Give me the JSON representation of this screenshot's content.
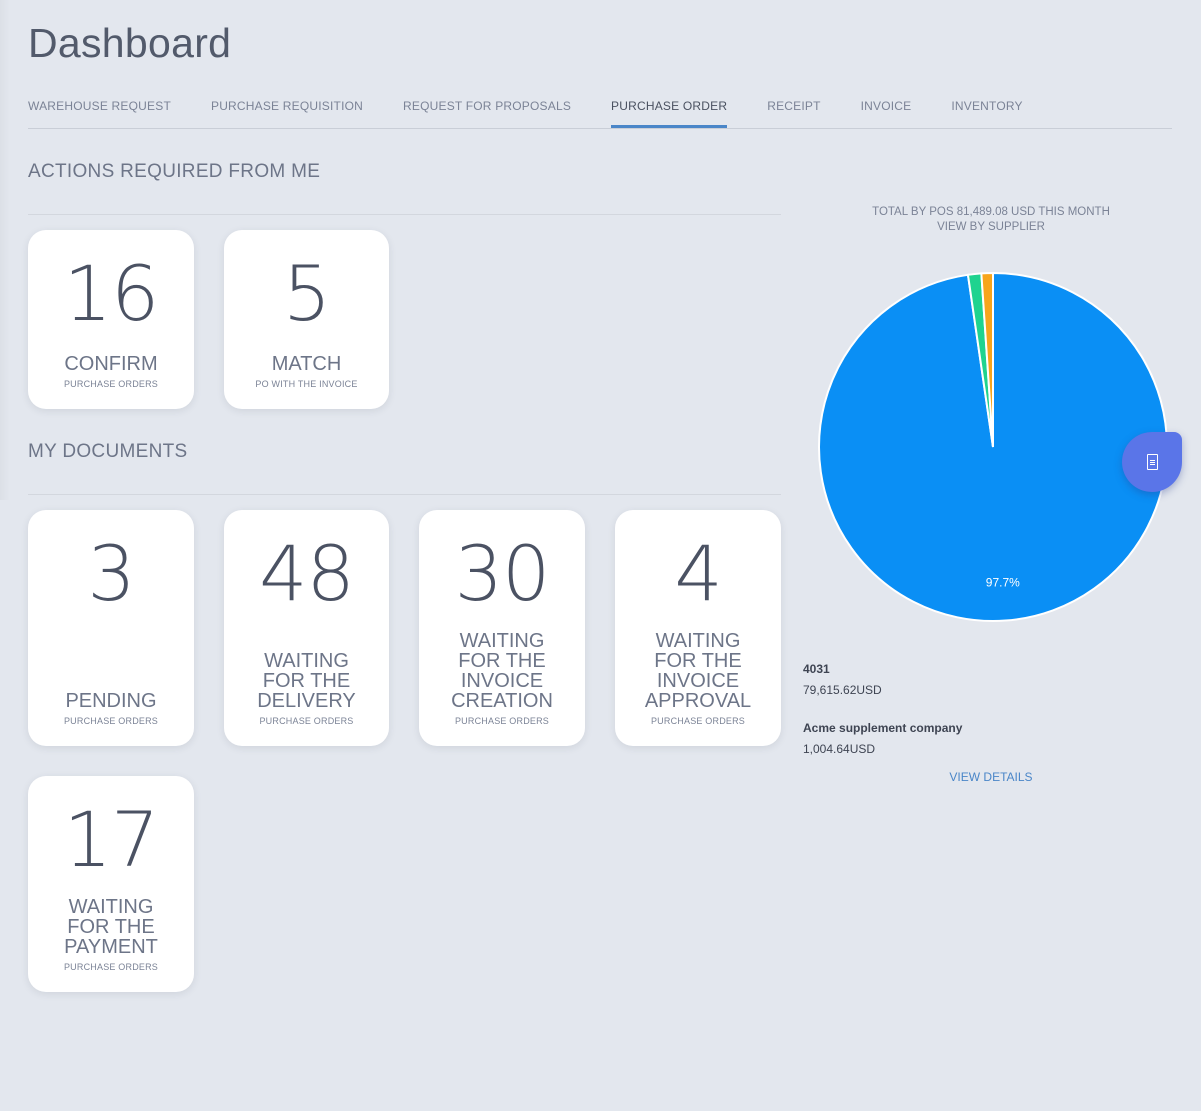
{
  "page": {
    "title": "Dashboard"
  },
  "tabs": [
    {
      "label": "WAREHOUSE REQUEST",
      "active": false
    },
    {
      "label": "PURCHASE REQUISITION",
      "active": false
    },
    {
      "label": "REQUEST FOR PROPOSALS",
      "active": false
    },
    {
      "label": "PURCHASE ORDER",
      "active": true
    },
    {
      "label": "RECEIPT",
      "active": false
    },
    {
      "label": "INVOICE",
      "active": false
    },
    {
      "label": "INVENTORY",
      "active": false
    }
  ],
  "actions": {
    "title": "ACTIONS REQUIRED FROM ME",
    "cards": [
      {
        "count": "16",
        "label": "CONFIRM",
        "sub": "PURCHASE ORDERS"
      },
      {
        "count": "5",
        "label": "MATCH",
        "sub": "PO WITH THE INVOICE"
      }
    ]
  },
  "documents": {
    "title": "MY DOCUMENTS",
    "cards": [
      {
        "count": "3",
        "label": "PENDING",
        "sub": "PURCHASE ORDERS"
      },
      {
        "count": "48",
        "label": "WAITING FOR THE DELIVERY",
        "sub": "PURCHASE ORDERS"
      },
      {
        "count": "30",
        "label": "WAITING FOR THE INVOICE CREATION",
        "sub": "PURCHASE ORDERS"
      },
      {
        "count": "4",
        "label": "WAITING FOR THE INVOICE APPROVAL",
        "sub": "PURCHASE ORDERS"
      },
      {
        "count": "17",
        "label": "WAITING FOR THE PAYMENT",
        "sub": "PURCHASE ORDERS"
      }
    ]
  },
  "chart": {
    "title_line1": "TOTAL BY POS 81,489.08 USD THIS MONTH",
    "title_line2": "VIEW BY SUPPLIER",
    "legend": [
      {
        "name": "4031",
        "amount": "79,615.62USD"
      },
      {
        "name": "Acme supplement company",
        "amount": "1,004.64USD"
      }
    ],
    "view_details_label": "VIEW DETAILS"
  },
  "chart_data": {
    "type": "pie",
    "title": "TOTAL BY POS 81,489.08 USD THIS MONTH",
    "subtitle": "VIEW BY SUPPLIER",
    "slices": [
      {
        "label": "4031",
        "value": 79615.62,
        "percent": 97.7,
        "color": "#0a8ff5",
        "data_label": "97.7%"
      },
      {
        "label": "Acme supplement company",
        "value": 1004.64,
        "percent": 1.2,
        "color": "#1fd38f",
        "data_label": ""
      },
      {
        "label": "",
        "value": 868.82,
        "percent": 1.1,
        "color": "#f7a51c",
        "data_label": ""
      }
    ]
  },
  "fab": {
    "icon": "document-icon"
  }
}
